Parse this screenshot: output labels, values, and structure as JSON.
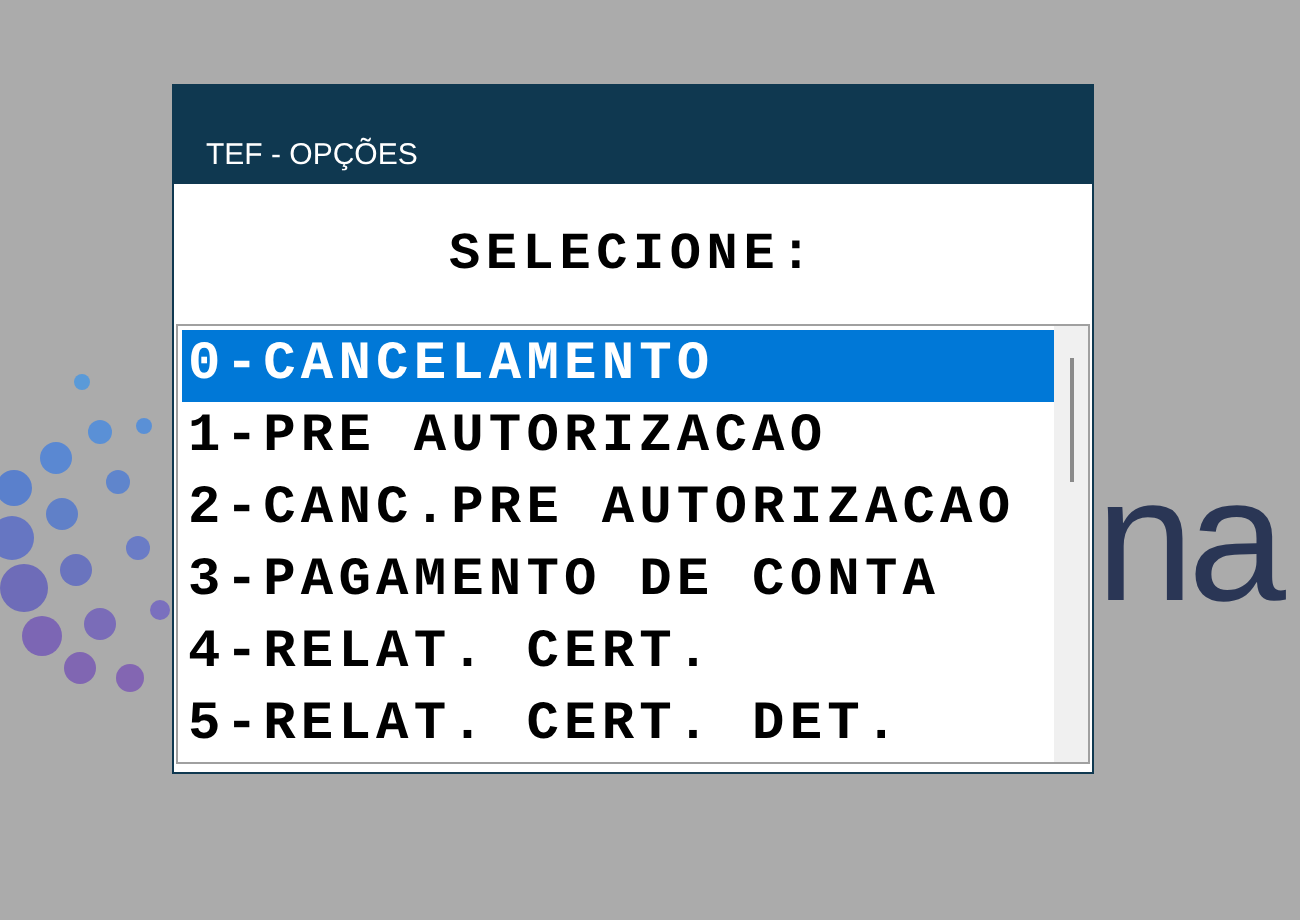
{
  "background_logo": {
    "text": "na"
  },
  "window": {
    "title": "TEF - OPÇÕES"
  },
  "prompt": "SELECIONE:",
  "options": [
    {
      "label": "0-CANCELAMENTO",
      "selected": true
    },
    {
      "label": "1-PRE AUTORIZACAO",
      "selected": false
    },
    {
      "label": "2-CANC.PRE AUTORIZACAO",
      "selected": false
    },
    {
      "label": "3-PAGAMENTO DE CONTA",
      "selected": false
    },
    {
      "label": "4-RELAT. CERT.",
      "selected": false
    },
    {
      "label": "5-RELAT. CERT. DET.",
      "selected": false
    }
  ]
}
